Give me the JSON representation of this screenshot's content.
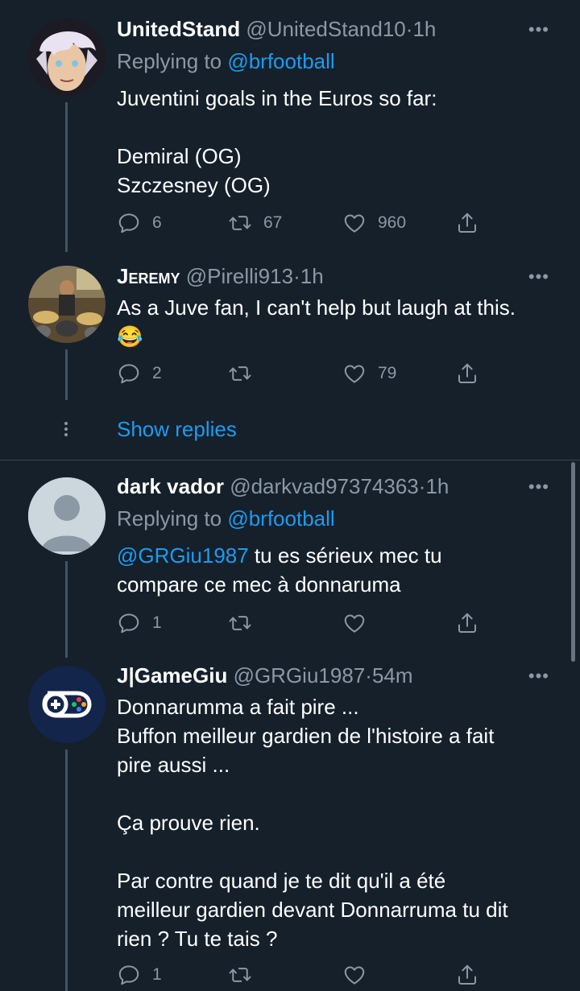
{
  "tweets": [
    {
      "name": "UnitedStand",
      "handle": "@UnitedStand10",
      "separator": "·",
      "time": "1h",
      "replying_prefix": "Replying to ",
      "replying_to": "@brfootball",
      "text": "Juventini goals in the Euros so far:\n\nDemiral (OG)\nSzczesney (OG)",
      "replies": "6",
      "retweets": "67",
      "likes": "960"
    },
    {
      "name": "Jeremy",
      "handle": "@Pirelli913",
      "separator": "·",
      "time": "1h",
      "text": "As a Juve fan, I can't help but laugh at this.\n😂",
      "replies": "2",
      "retweets": "",
      "likes": "79"
    },
    {
      "name": "dark vador",
      "handle": "@darkvad97374363",
      "separator": "·",
      "time": "1h",
      "replying_prefix": "Replying to ",
      "replying_to": "@brfootball",
      "mention": "@GRGiu1987",
      "text_after_mention": " tu es sérieux mec tu",
      "text_line2": "compare ce mec à donnaruma",
      "replies": "1",
      "retweets": "",
      "likes": ""
    },
    {
      "name": "J|GameGiu",
      "handle": "@GRGiu1987",
      "separator": "·",
      "time": "54m",
      "text": "Donnarumma a fait pire ...\nBuffon meilleur gardien de l'histoire a fait\npire aussi ...\n\nÇa prouve rien.\n\nPar contre quand je te dit qu'il a été\nmeilleur gardien devant Donnarruma tu dit\nrien ? Tu te tais ?",
      "replies": "1",
      "retweets": "",
      "likes": ""
    }
  ],
  "show_replies_label": "Show replies",
  "more_glyph": "•••",
  "icons": [
    "reply-icon",
    "retweet-icon",
    "like-icon",
    "share-icon",
    "more-icon"
  ],
  "colors": {
    "background": "#15202b",
    "link": "#1d9bf0",
    "muted": "#8b98a5",
    "thread_line": "#3d5466"
  }
}
